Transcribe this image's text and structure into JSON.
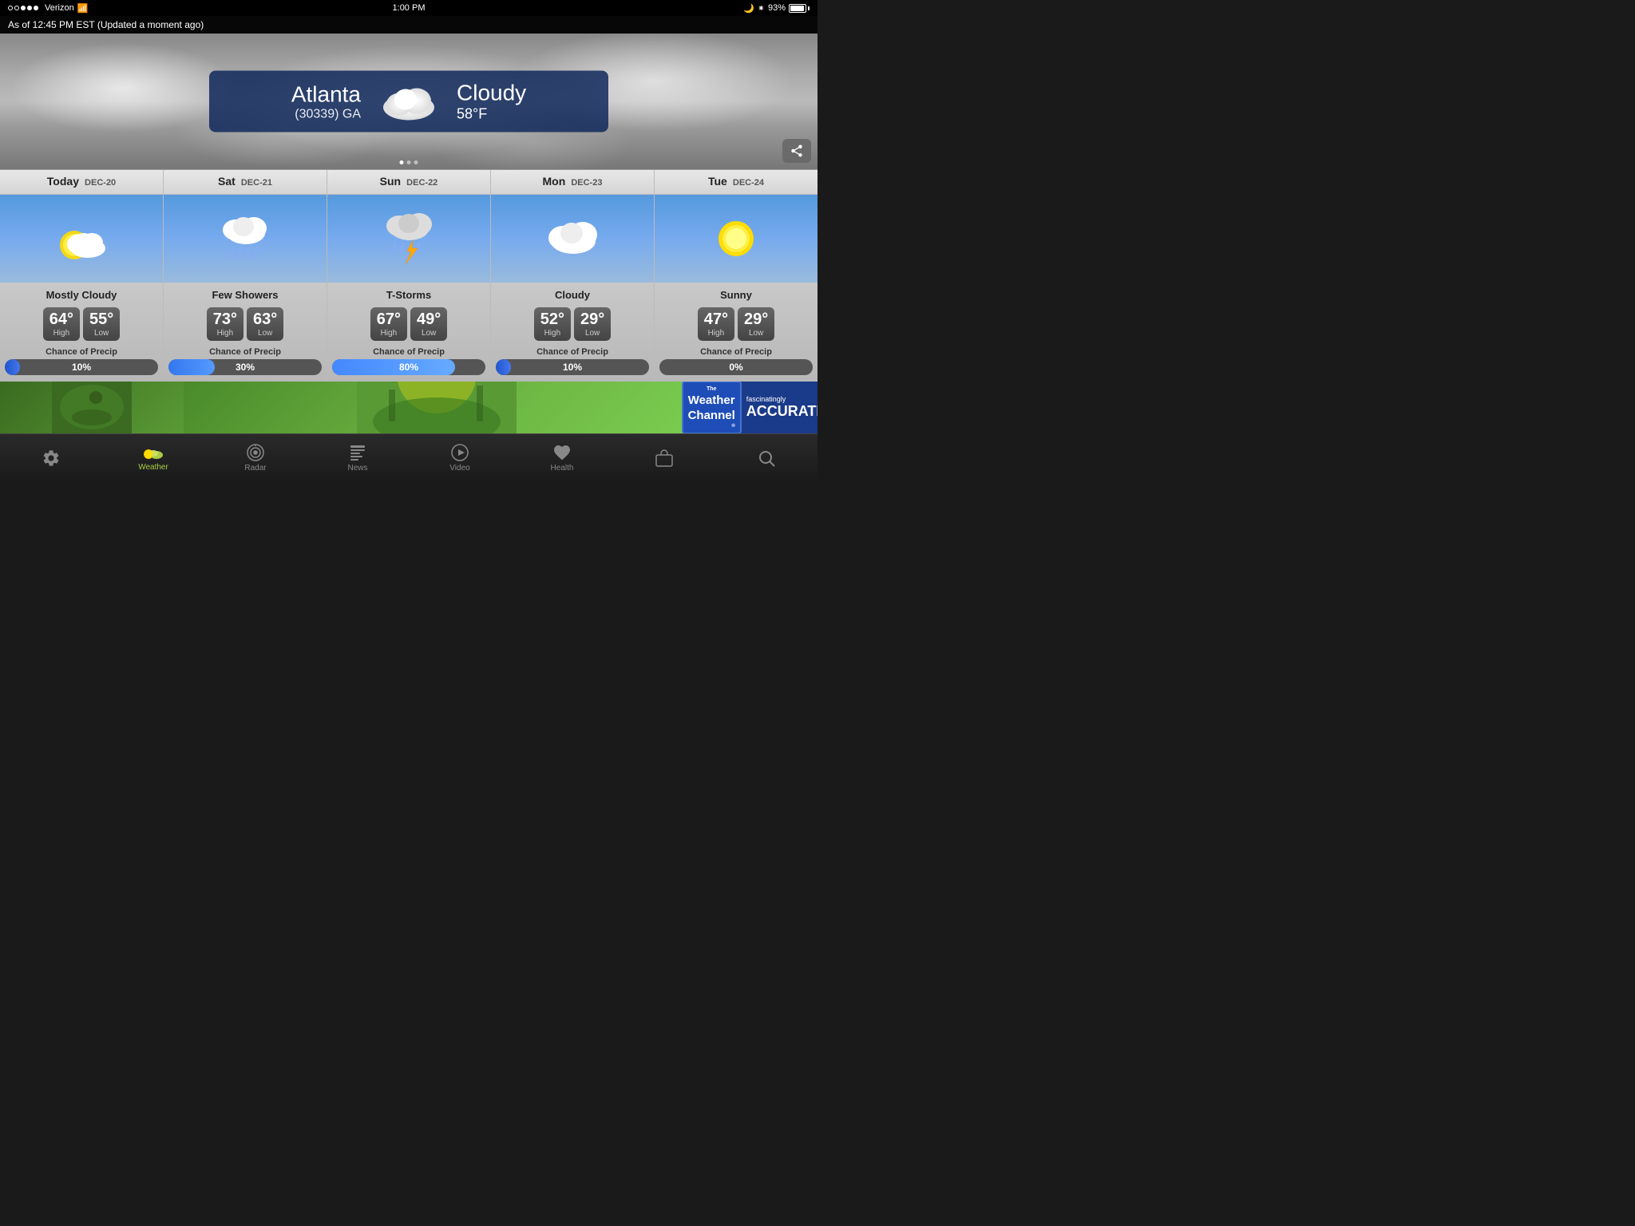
{
  "statusBar": {
    "carrier": "Verizon",
    "time": "1:00 PM",
    "battery": "93%"
  },
  "updateBar": {
    "text": "As of 12:45 PM EST (Updated a moment ago)"
  },
  "currentWeather": {
    "city": "Atlanta",
    "zipState": "(30339) GA",
    "condition": "Cloudy",
    "temp": "58°F",
    "shareLabel": "↑"
  },
  "forecast": [
    {
      "dayName": "Today",
      "dayDate": "DEC-20",
      "condition": "Mostly Cloudy",
      "highTemp": "64°",
      "lowTemp": "55°",
      "highLabel": "High",
      "lowLabel": "Low",
      "precipLabel": "Chance of Precip",
      "precipPct": "10%",
      "precipFill": 10,
      "iconType": "partly-cloudy"
    },
    {
      "dayName": "Sat",
      "dayDate": "DEC-21",
      "condition": "Few Showers",
      "highTemp": "73°",
      "lowTemp": "63°",
      "highLabel": "High",
      "lowLabel": "Low",
      "precipLabel": "Chance of Precip",
      "precipPct": "30%",
      "precipFill": 30,
      "iconType": "rain"
    },
    {
      "dayName": "Sun",
      "dayDate": "DEC-22",
      "condition": "T-Storms",
      "highTemp": "67°",
      "lowTemp": "49°",
      "highLabel": "High",
      "lowLabel": "Low",
      "precipLabel": "Chance of Precip",
      "precipPct": "80%",
      "precipFill": 80,
      "iconType": "tstorm"
    },
    {
      "dayName": "Mon",
      "dayDate": "DEC-23",
      "condition": "Cloudy",
      "highTemp": "52°",
      "lowTemp": "29°",
      "highLabel": "High",
      "lowLabel": "Low",
      "precipLabel": "Chance of Precip",
      "precipPct": "10%",
      "precipFill": 10,
      "iconType": "cloudy"
    },
    {
      "dayName": "Tue",
      "dayDate": "DEC-24",
      "condition": "Sunny",
      "highTemp": "47°",
      "lowTemp": "29°",
      "highLabel": "High",
      "lowLabel": "Low",
      "precipLabel": "Chance of Precip",
      "precipPct": "0%",
      "precipFill": 0,
      "iconType": "sunny"
    }
  ],
  "ad": {
    "tagline": "fascinatinglyACCURATE",
    "brand": "The Weather Channel"
  },
  "bottomNav": {
    "items": [
      {
        "id": "settings",
        "label": "",
        "icon": "⚙️",
        "active": false
      },
      {
        "id": "weather",
        "label": "Weather",
        "icon": "🌤",
        "active": true
      },
      {
        "id": "radar",
        "label": "Radar",
        "icon": "📡",
        "active": false
      },
      {
        "id": "news",
        "label": "News",
        "icon": "📰",
        "active": false
      },
      {
        "id": "video",
        "label": "Video",
        "icon": "▶️",
        "active": false
      },
      {
        "id": "health",
        "label": "Health",
        "icon": "💗",
        "active": false
      },
      {
        "id": "bag",
        "label": "",
        "icon": "🧳",
        "active": false
      },
      {
        "id": "search",
        "label": "",
        "icon": "🔍",
        "active": false
      }
    ]
  }
}
